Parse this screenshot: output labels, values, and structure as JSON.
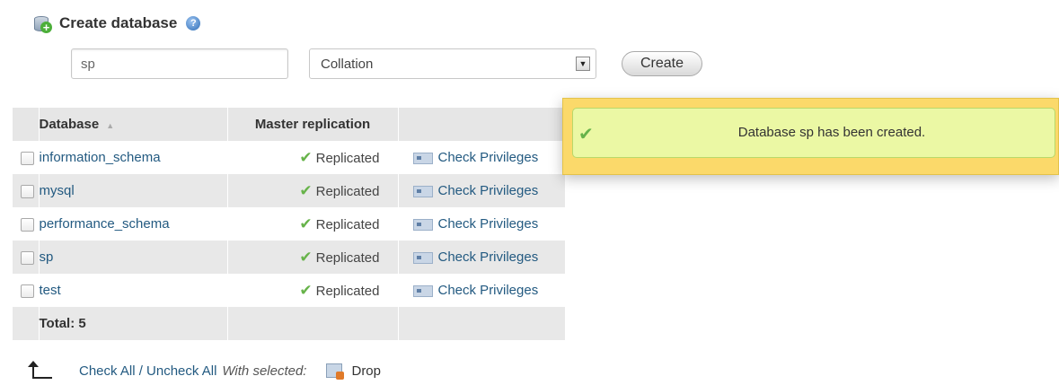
{
  "create_db": {
    "title": "Create database",
    "icon": "database-add-icon",
    "help_icon": "help-icon",
    "name_value": "sp",
    "collation_selected": "Collation",
    "create_label": "Create"
  },
  "table": {
    "headers": {
      "database": "Database",
      "master_replication": "Master replication"
    },
    "rows": [
      {
        "name": "information_schema",
        "replication": "Replicated",
        "action": "Check Privileges"
      },
      {
        "name": "mysql",
        "replication": "Replicated",
        "action": "Check Privileges"
      },
      {
        "name": "performance_schema",
        "replication": "Replicated",
        "action": "Check Privileges"
      },
      {
        "name": "sp",
        "replication": "Replicated",
        "action": "Check Privileges"
      },
      {
        "name": "test",
        "replication": "Replicated",
        "action": "Check Privileges"
      }
    ],
    "total_label": "Total: 5"
  },
  "footer": {
    "check_all": "Check All / Uncheck All",
    "with_selected": "With selected:",
    "drop_label": "Drop"
  },
  "notification": {
    "message": "Database sp has been created.",
    "colors": {
      "outer": "#fbd96a",
      "inner": "#ebf8a4"
    }
  },
  "colors": {
    "link": "#235a81",
    "success": "#67b34a"
  }
}
